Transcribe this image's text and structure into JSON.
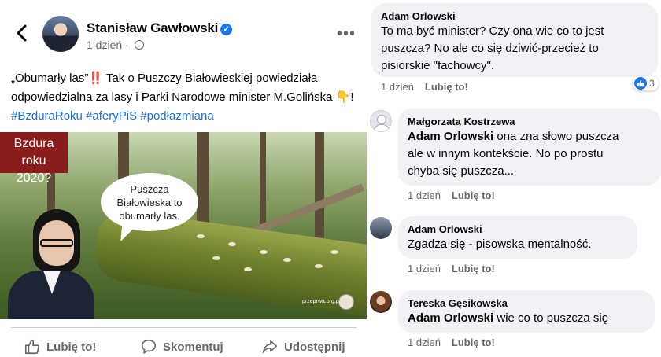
{
  "post": {
    "author": "Stanisław Gawłowski",
    "time": "1 dzień",
    "text_intro": "„Obumarły las”",
    "text_exclaim": "‼️",
    "text_main": " Tak o Puszczy Białowieskiej powiedziała odpowiedzialna za lasy i Parki Narodowe minister M.Golińska ",
    "text_pointer": "👇",
    "text_bang": "! ",
    "hashtags": [
      "#BzduraRoku",
      "#aferyPiS",
      "#podłazmiana"
    ],
    "image": {
      "title_line1": "Bzdura roku",
      "title_line2": "2020?",
      "bubble_line1": "Puszcza",
      "bubble_line2": "Białowieska to",
      "bubble_line3": "obumarły las.",
      "watermark": "przeprwa.org.pl"
    },
    "actions": {
      "like": "Lubię to!",
      "comment": "Skomentuj",
      "share": "Udostępnij"
    }
  },
  "comments": [
    {
      "name": "Adam Orlowski",
      "lines": [
        "To ma być minister? Czy ona wie co to jest",
        "puszcza? No ale co się dziwić-przecież to",
        "pisiorskie \"fachowcy\"."
      ],
      "time": "1 dzień",
      "like_label": "Lubię to!",
      "reaction_count": "3"
    },
    {
      "name": "Małgorzata Kostrzewa",
      "mention": "Adam Orlowski",
      "lines": [
        " ona zna słowo puszcza",
        "ale w innym kontekście. No po prostu",
        "chyba się puszcza..."
      ],
      "time": "1 dzień",
      "like_label": "Lubię to!"
    },
    {
      "name": "Adam Orlowski",
      "lines": [
        "Zgadza się - pisowska mentalność."
      ],
      "time": "1 dzień",
      "like_label": "Lubię to!"
    },
    {
      "name": "Tereska Gęsikowska",
      "mention": "Adam Orlowski",
      "lines": [
        " wie co to puszcza się"
      ],
      "time": "1 dzień",
      "like_label": "Lubię to!"
    }
  ],
  "colors": {
    "accent_blue": "#1877f2",
    "hashtag": "#216fdb",
    "meta_gray": "#65676b",
    "bubble_bg": "#f0f2f5",
    "title_box": "#8a1c1b"
  }
}
